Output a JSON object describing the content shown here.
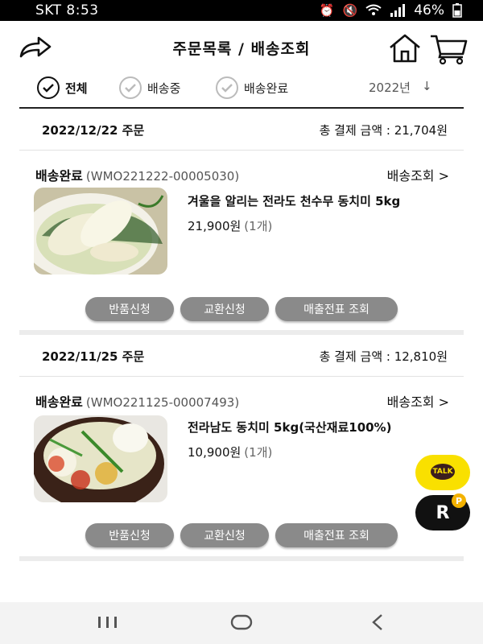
{
  "statusbar": {
    "carrier_time": "SKT 8:53",
    "battery": "46%"
  },
  "header": {
    "title": "주문목록 / 배송조회"
  },
  "filters": [
    {
      "label": "전체",
      "checked": true
    },
    {
      "label": "배송중",
      "checked": false
    },
    {
      "label": "배송완료",
      "checked": false
    }
  ],
  "year_filter": "2022년",
  "orders": [
    {
      "date": "2022/12/22 주문",
      "total": "총 결제 금액 : 21,704원",
      "status": "배송완료",
      "code": "(WMO221222-00005030)",
      "track": "배송조회 >",
      "product": "겨울을 알리는 전라도 천수무 동치미 5kg",
      "price": "21,900원",
      "qty": "(1개)",
      "buttons": [
        "반품신청",
        "교환신청",
        "매출전표 조회"
      ]
    },
    {
      "date": "2022/11/25 주문",
      "total": "총 결제 금액 : 12,810원",
      "status": "배송완료",
      "code": "(WMO221125-00007493)",
      "track": "배송조회 >",
      "product": "전라남도 동치미 5kg(국산재료100%)",
      "price": "10,900원",
      "qty": "(1개)",
      "buttons": [
        "반품신청",
        "교환신청",
        "매출전표 조회"
      ]
    }
  ],
  "floating": {
    "talk": "TALK",
    "r": "R",
    "coin": "P"
  },
  "colors": {
    "button_gray": "#8a8a8a",
    "kakao_yellow": "#f9e000"
  }
}
